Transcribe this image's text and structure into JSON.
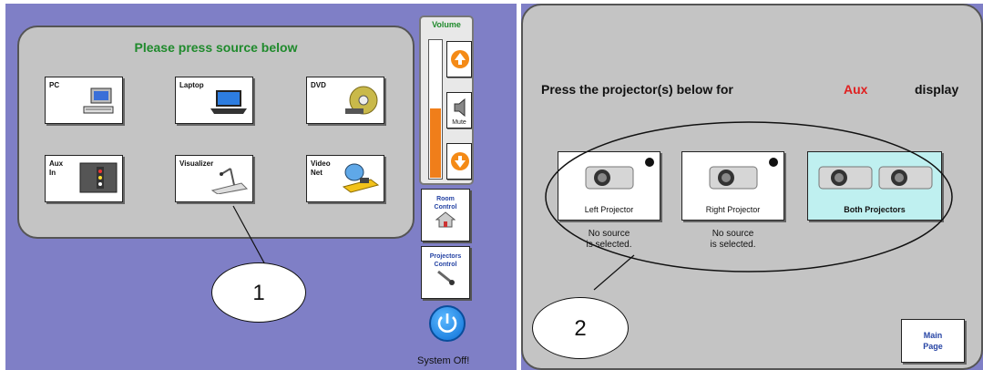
{
  "left_screen": {
    "source_title": "Please press source below",
    "sources": [
      {
        "label": "PC",
        "icon": "pc-icon"
      },
      {
        "label": "Laptop",
        "icon": "laptop-icon"
      },
      {
        "label": "DVD",
        "icon": "dvd-icon"
      },
      {
        "label": "Aux\nIn",
        "icon": "aux-in-icon"
      },
      {
        "label": "Visualizer",
        "icon": "visualizer-icon"
      },
      {
        "label": "Video\nNet",
        "icon": "video-net-icon"
      }
    ],
    "volume": {
      "title": "Volume",
      "level_fraction": 0.5,
      "up_icon": "volume-up-icon",
      "mute_label": "Mute",
      "down_icon": "volume-down-icon"
    },
    "room_control_label": "Room\nControl",
    "projectors_control_label": "Projectors\nControl",
    "system_off_label": "System Off!",
    "callout_number": "1",
    "colors": {
      "background": "#7f7fc6",
      "title_green": "#1f8a2c",
      "volume_fill": "#f07e1a",
      "power_blue": "#0c6fd6"
    }
  },
  "right_screen": {
    "heading": "Press the projector(s) below for",
    "source_name": "Aux",
    "heading_suffix": "display",
    "projectors": [
      {
        "label": "Left Projector",
        "status": "No source\nis selected.",
        "selected": false
      },
      {
        "label": "Right Projector",
        "status": "No source\nis selected.",
        "selected": false
      },
      {
        "label": "Both Projectors",
        "status": "",
        "selected": true
      }
    ],
    "main_page_label": "Main\nPage",
    "callout_number": "2",
    "colors": {
      "source_red": "#e02020",
      "selected_bg": "#bff0f0"
    }
  }
}
